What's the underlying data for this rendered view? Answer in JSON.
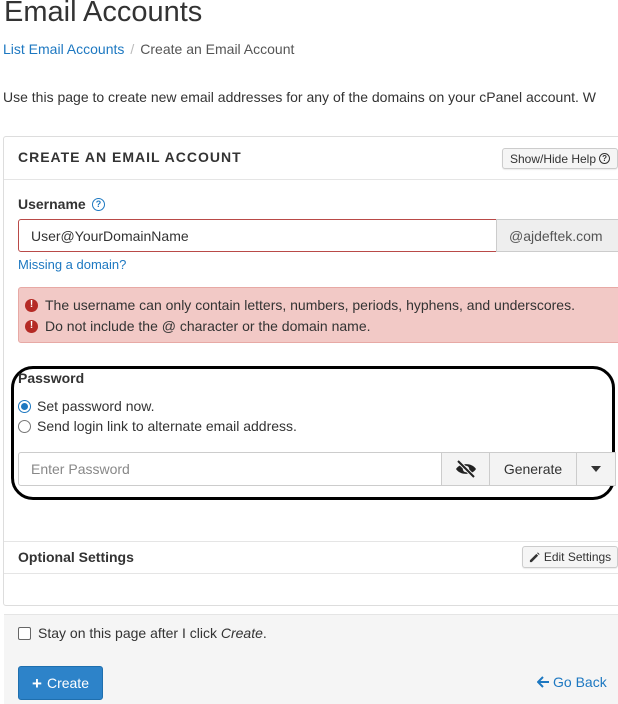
{
  "page": {
    "title": "Email Accounts",
    "intro": "Use this page to create new email addresses for any of the domains on your cPanel account. W"
  },
  "breadcrumb": {
    "link": "List Email Accounts",
    "separator": "/",
    "current": "Create an Email Account"
  },
  "panel": {
    "title": "CREATE AN EMAIL ACCOUNT",
    "help_button": "Show/Hide Help"
  },
  "username": {
    "label": "Username",
    "value": "User@YourDomainName",
    "domain": "@ajdeftek.com",
    "missing_domain_link": "Missing a domain?",
    "errors": [
      "The username can only contain letters, numbers, periods, hyphens, and underscores.",
      "Do not include the @ character or the domain name."
    ]
  },
  "password": {
    "label": "Password",
    "options": [
      {
        "label": "Set password now.",
        "selected": true
      },
      {
        "label": "Send login link to alternate email address.",
        "selected": false
      }
    ],
    "placeholder": "Enter Password",
    "generate_label": "Generate"
  },
  "optional": {
    "title": "Optional Settings",
    "edit_button": "Edit Settings"
  },
  "footer": {
    "stay_text": "Stay on this page after I click ",
    "stay_emphasis": "Create",
    "stay_end": ".",
    "stay_checked": false,
    "create_label": "Create",
    "go_back_label": "Go Back"
  },
  "colors": {
    "link": "#1d78c1",
    "error_bg": "#f2c9c6",
    "error_icon": "#b52a25",
    "primary_button": "#2d83c9"
  }
}
